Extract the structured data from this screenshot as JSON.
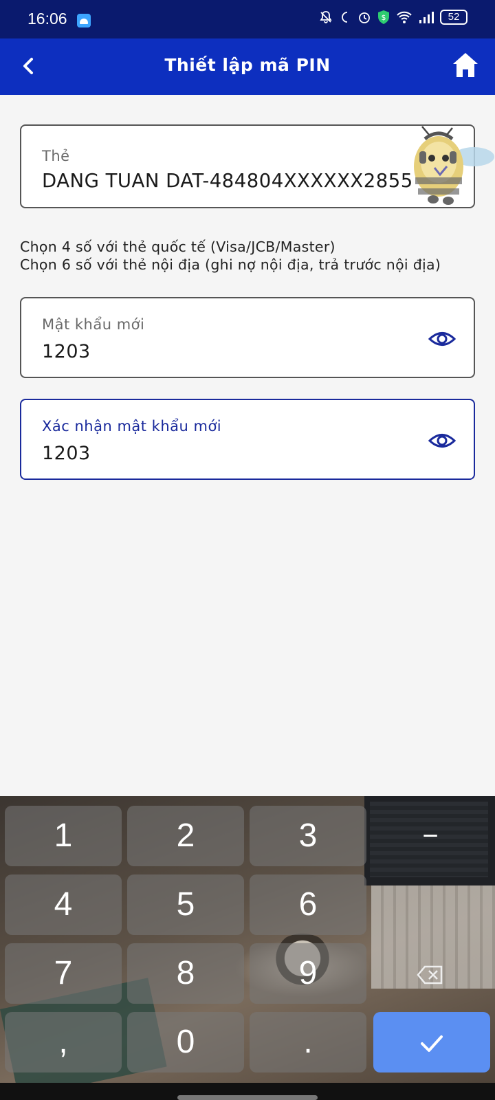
{
  "status_bar": {
    "time": "16:06",
    "battery": "52",
    "icons": [
      "android-app-icon",
      "bell-muted-icon",
      "moon-icon",
      "alarm-icon",
      "shield-dollar-icon",
      "wifi-icon",
      "signal-icon",
      "battery-icon"
    ]
  },
  "header": {
    "title": "Thiết lập mã PIN",
    "back_icon": "chevron-left-icon",
    "home_icon": "home-icon",
    "background": "#0d2fbf"
  },
  "card_field": {
    "label": "Thẻ",
    "value": "DANG TUAN DAT-484804XXXXXX2855"
  },
  "hint": {
    "line1": "Chọn 4 số với thẻ quốc tế (Visa/JCB/Master)",
    "line2": "Chọn 6 số với thẻ nội địa (ghi nợ nội địa, trả trước nội địa)"
  },
  "new_password": {
    "label": "Mật khẩu mới",
    "value": "1203"
  },
  "confirm_password": {
    "label": "Xác nhận mật khẩu mới",
    "value": "1203"
  },
  "keyboard": {
    "keys": {
      "k1": "1",
      "k2": "2",
      "k3": "3",
      "minus": "−",
      "k4": "4",
      "k5": "5",
      "k6": "6",
      "k7": "7",
      "k8": "8",
      "k9": "9",
      "comma": ",",
      "k0": "0",
      "dot": "."
    },
    "ok_color": "#5b8ff2"
  }
}
